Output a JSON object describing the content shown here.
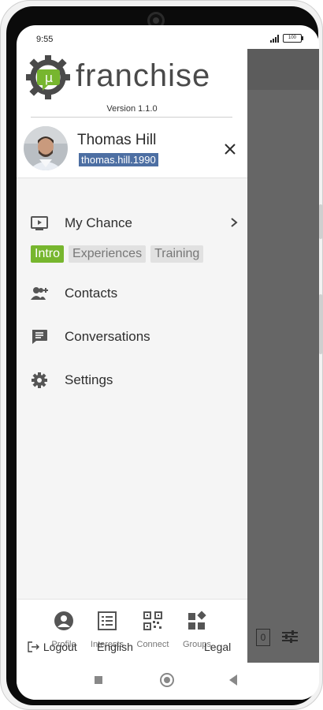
{
  "status_bar": {
    "time": "9:55",
    "battery": "100"
  },
  "app": {
    "logo_text": "franchise",
    "logo_symbol": "µ",
    "version": "Version 1.1.0",
    "brand_green": "#77b62e"
  },
  "user": {
    "name": "Thomas Hill",
    "handle": "thomas.hill.1990"
  },
  "menu": {
    "my_chance": "My Chance",
    "chips": [
      "Intro",
      "Experiences",
      "Training"
    ],
    "contacts": "Contacts",
    "conversations": "Conversations",
    "settings": "Settings"
  },
  "footer": {
    "tabs": [
      "Profile",
      "Interests",
      "Connect",
      "Groups"
    ],
    "logout": "Logout",
    "language": "English",
    "legal": "Legal"
  },
  "background_screen": {
    "count": "0"
  },
  "icons": [
    "close-icon",
    "video-icon",
    "chevron-right-icon",
    "add-contact-icon",
    "chat-icon",
    "gear-icon",
    "profile-icon",
    "interests-icon",
    "qr-code-icon",
    "groups-icon",
    "logout-icon",
    "filter-icon"
  ]
}
